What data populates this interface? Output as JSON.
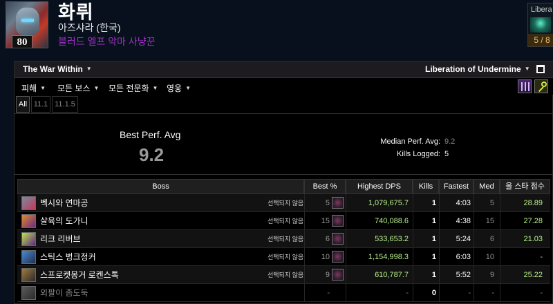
{
  "character": {
    "name": "화뤼",
    "realm": "아즈샤라 (한국)",
    "spec": "블러드 엘프 악마 사냥꾼",
    "level": "80",
    "spec_color": "#a330c9"
  },
  "raid_mini": {
    "title": "Libera",
    "progress": "5 / 8"
  },
  "toolbar": {
    "expansion": "The War Within",
    "raid": "Liberation of Undermine",
    "metric": "피해",
    "boss_filter": "모든 보스",
    "spec_filter": "모든 전문화",
    "difficulty": "영웅"
  },
  "tabs": [
    "All",
    "11.1",
    "11.1.5"
  ],
  "summary": {
    "best_label": "Best Perf. Avg",
    "best_value": "9.2",
    "median_label": "Median Perf. Avg:",
    "median_value": "9.2",
    "kills_label": "Kills Logged:",
    "kills_value": "5"
  },
  "table": {
    "headers": [
      "Boss",
      "Best %",
      "Highest DPS",
      "Kills",
      "Fastest",
      "Med",
      "올 스타 점수"
    ],
    "unselected_text": "선택되지 않음",
    "rows": [
      {
        "boss": "벡시와 연마공",
        "best": "5",
        "dps": "1,079,675.7",
        "kills": "1",
        "fastest": "4:03",
        "med": "5",
        "score": "28.89",
        "icon": "boss-vexie-icon"
      },
      {
        "boss": "살육의 도가니",
        "best": "15",
        "dps": "740,088.6",
        "kills": "1",
        "fastest": "4:38",
        "med": "15",
        "score": "27.28",
        "icon": "boss-cauldron-icon"
      },
      {
        "boss": "리크 리버브",
        "best": "6",
        "dps": "533,653.2",
        "kills": "1",
        "fastest": "5:24",
        "med": "6",
        "score": "21.03",
        "icon": "boss-rik-icon"
      },
      {
        "boss": "스틱스 벙크정커",
        "best": "10",
        "dps": "1,154,998.3",
        "kills": "1",
        "fastest": "6:03",
        "med": "10",
        "score": "-",
        "icon": "boss-stix-icon"
      },
      {
        "boss": "스프로켓몽거 로켄스톡",
        "best": "9",
        "dps": "610,787.7",
        "kills": "1",
        "fastest": "5:52",
        "med": "9",
        "score": "25.22",
        "icon": "boss-sprocket-icon"
      },
      {
        "boss": "외팔이 좀도둑",
        "best": "-",
        "dps": "-",
        "kills": "0",
        "fastest": "-",
        "med": "-",
        "score": "-",
        "icon": "boss-bandit-icon"
      }
    ]
  },
  "colors": {
    "parse_gray": "#9a9a9a",
    "dps_green": "#b8f08a",
    "background": "#07101c"
  }
}
